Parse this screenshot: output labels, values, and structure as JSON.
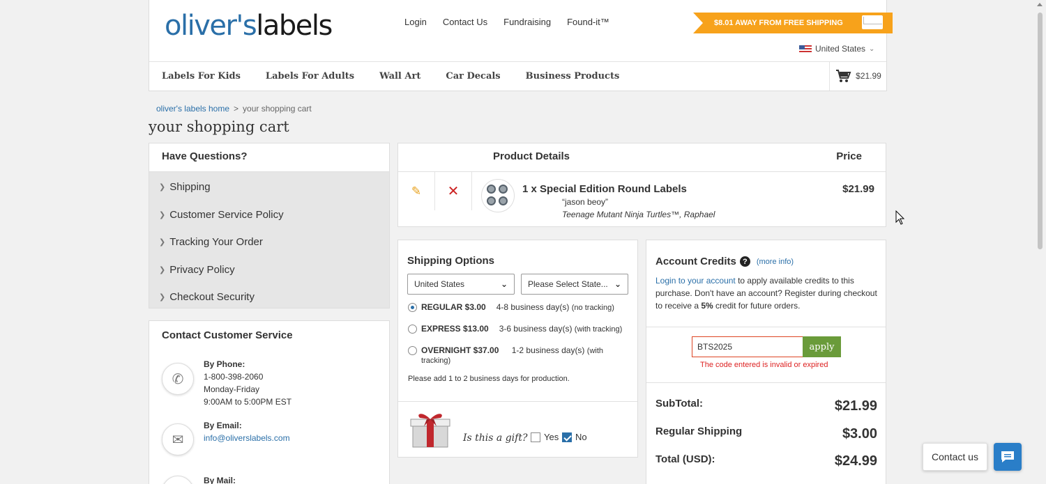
{
  "header": {
    "logo_part1": "oliver's",
    "logo_part2": "labels",
    "top_links": [
      "Login",
      "Contact Us",
      "Fundraising",
      "Found-it™"
    ],
    "free_shipping_banner": "$8.01 AWAY FROM FREE SHIPPING",
    "country": "United States",
    "nav": [
      "Labels For Kids",
      "Labels For Adults",
      "Wall Art",
      "Car Decals",
      "Business Products"
    ],
    "cart_total": "$21.99"
  },
  "breadcrumb": {
    "home": "oliver's labels home",
    "sep": ">",
    "current": "your shopping cart"
  },
  "page_title": "your shopping cart",
  "questions": {
    "title": "Have Questions?",
    "items": [
      "Shipping",
      "Customer Service Policy",
      "Tracking Your Order",
      "Privacy Policy",
      "Checkout Security"
    ]
  },
  "contact": {
    "title": "Contact Customer Service",
    "phone_label": "By Phone:",
    "phone": "1-800-398-2060",
    "days": "Monday-Friday",
    "hours": "9:00AM to 5:00PM EST",
    "email_label": "By Email:",
    "email": "info@oliverslabels.com",
    "mail_label": "By Mail:"
  },
  "product": {
    "header_details": "Product Details",
    "header_price": "Price",
    "qty_title": "1 x  Special Edition Round Labels",
    "quote": "“jason beoy”",
    "subtitle": "Teenage Mutant Ninja Turtles™, Raphael",
    "price": "$21.99"
  },
  "shipping": {
    "title": "Shipping Options",
    "country_select": "United States",
    "state_select": "Please Select State...",
    "options": [
      {
        "name": "REGULAR $3.00",
        "days": "4-8 business day(s)",
        "note": "(no tracking)",
        "selected": true
      },
      {
        "name": "EXPRESS $13.00",
        "days": "3-6 business day(s)",
        "note": "(with tracking)",
        "selected": false
      },
      {
        "name": "OVERNIGHT $37.00",
        "days": "1-2 business day(s)",
        "note": "(with",
        "note2": "tracking)",
        "selected": false
      }
    ],
    "production_note": "Please add 1 to 2 business days for production.",
    "gift_question": "Is this a gift?",
    "gift_yes": "Yes",
    "gift_no": "No",
    "gift_selected": "No"
  },
  "credits": {
    "title": "Account Credits",
    "more_info": "(more info)",
    "login_link": "Login to your account",
    "text_after_link": " to apply available credits to this purchase. Don't have an account? Register during checkout to receive a ",
    "percent": "5%",
    "text_end": " credit for future orders.",
    "code_value": "BTS2025",
    "apply_label": "apply",
    "error": "The code entered is invalid or expired",
    "subtotal_label": "SubTotal:",
    "subtotal": "$21.99",
    "shipping_label": "Regular Shipping",
    "shipping": "$3.00",
    "total_label": "Total (USD):",
    "total": "$24.99"
  },
  "chat": {
    "contact_us": "Contact us"
  },
  "colors": {
    "accent_blue": "#2a6fa8",
    "banner_orange": "#f7a21b",
    "apply_green": "#6a9b3a",
    "error_red": "#d22222"
  },
  "icons": [
    "pencil-icon",
    "delete-x-icon",
    "phone-icon",
    "envelope-icon",
    "cart-icon",
    "question-icon",
    "chat-icon",
    "chevron-down-icon"
  ]
}
